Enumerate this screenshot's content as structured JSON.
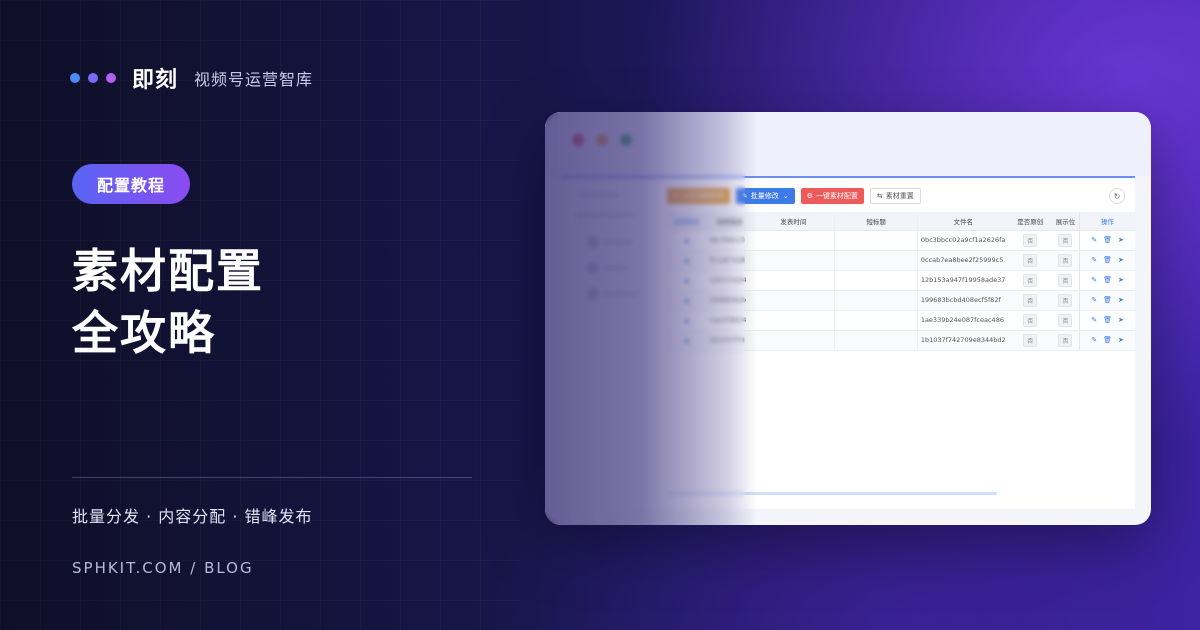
{
  "brand": {
    "dot_colors": [
      "#4a8cf7",
      "#7b6af5",
      "#b25ef0"
    ],
    "name": "即刻",
    "subtitle": "视频号运营智库"
  },
  "badge": "配置教程",
  "title": {
    "line1": "素材配置",
    "line2": "全攻略"
  },
  "features": "批量分发 · 内容分配 · 错峰发布",
  "site": "SPHKIT.COM / BLOG",
  "window": {
    "traffic_dots": [
      "#e0565b",
      "#e3a93b",
      "#3fb46a"
    ],
    "toolbar": [
      {
        "icon": "upload-icon",
        "label": "上传消费账号",
        "color": "#e8a33a"
      },
      {
        "icon": "edit-icon",
        "label": "批量修改",
        "color": "#3d7be8",
        "dropdown": true
      },
      {
        "icon": "settings-icon",
        "label": "一键素材配置",
        "color": "#ee5a5a"
      },
      {
        "icon": "reset-icon",
        "label": "素材重置",
        "color": "#ffffff"
      }
    ],
    "table": {
      "headers": [
        "视频预览",
        "视频描述",
        "发表时间",
        "短标题",
        "文件名",
        "是否原创",
        "展示位",
        "操作"
      ],
      "rows": [
        {
          "desc": "0bc3bbcc0",
          "file": "0bc3bbcc02a9cf1a2626fa",
          "orig": "否",
          "show": "否"
        },
        {
          "desc": "0ccab7ea8",
          "file": "0ccab7ea8bee2f25999c5",
          "orig": "否",
          "show": "否"
        },
        {
          "desc": "12b153a94",
          "file": "12b153a947f19958ade37",
          "orig": "否",
          "show": "否"
        },
        {
          "desc": "199683bcb",
          "file": "199683bcbd408ecf5f82f",
          "orig": "否",
          "show": "否"
        },
        {
          "desc": "1ae339b24",
          "file": "1ae339b24e087fceac486",
          "orig": "否",
          "show": "否"
        },
        {
          "desc": "1b1037f74",
          "file": "1b1037f742709e8344bd2",
          "orig": "否",
          "show": "否"
        }
      ]
    }
  }
}
